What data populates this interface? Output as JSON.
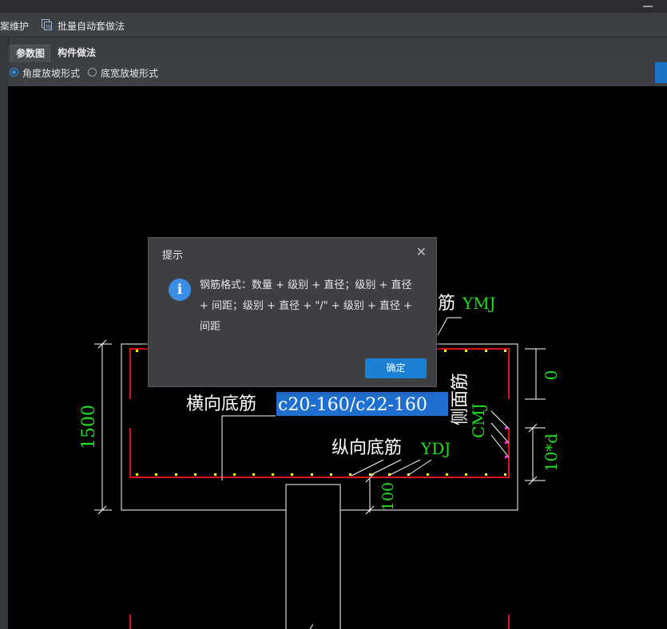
{
  "toolbar": {
    "item1_label": "案维护",
    "item2_label": "批量自动套做法"
  },
  "tabs": [
    {
      "label": "参数图",
      "active": true
    },
    {
      "label": "构件做法",
      "active": false
    }
  ],
  "options": {
    "radio1_label": "角度放坡形式",
    "radio1_checked": true,
    "radio2_label": "底宽放坡形式",
    "radio2_checked": false
  },
  "drawing": {
    "dim_height": "1500",
    "dim_top": "0",
    "dim_side": "10*d",
    "dim_bottom": "100",
    "transverse_label": "横向底筋",
    "transverse_value": "c20-160/c22-160",
    "longitudinal_label": "纵向底筋",
    "longitudinal_code": "YDJ",
    "top_label_tail": "筋",
    "top_code": "YMJ",
    "side_label": "侧面筋",
    "side_code": "CMJ",
    "colors": {
      "dim": "#1ee01e",
      "rebar": "#e01010",
      "outline": "#ffffff",
      "dot": "#ffff00",
      "highlight": "#1f6fd0"
    }
  },
  "dialog": {
    "title": "提示",
    "message": "钢筋格式：数量 + 级别 + 直径；级别 + 直径 + 间距；级别 + 直径 + \"/\" + 级别 + 直径 + 间距",
    "ok_label": "确定",
    "icon": "info-icon"
  }
}
